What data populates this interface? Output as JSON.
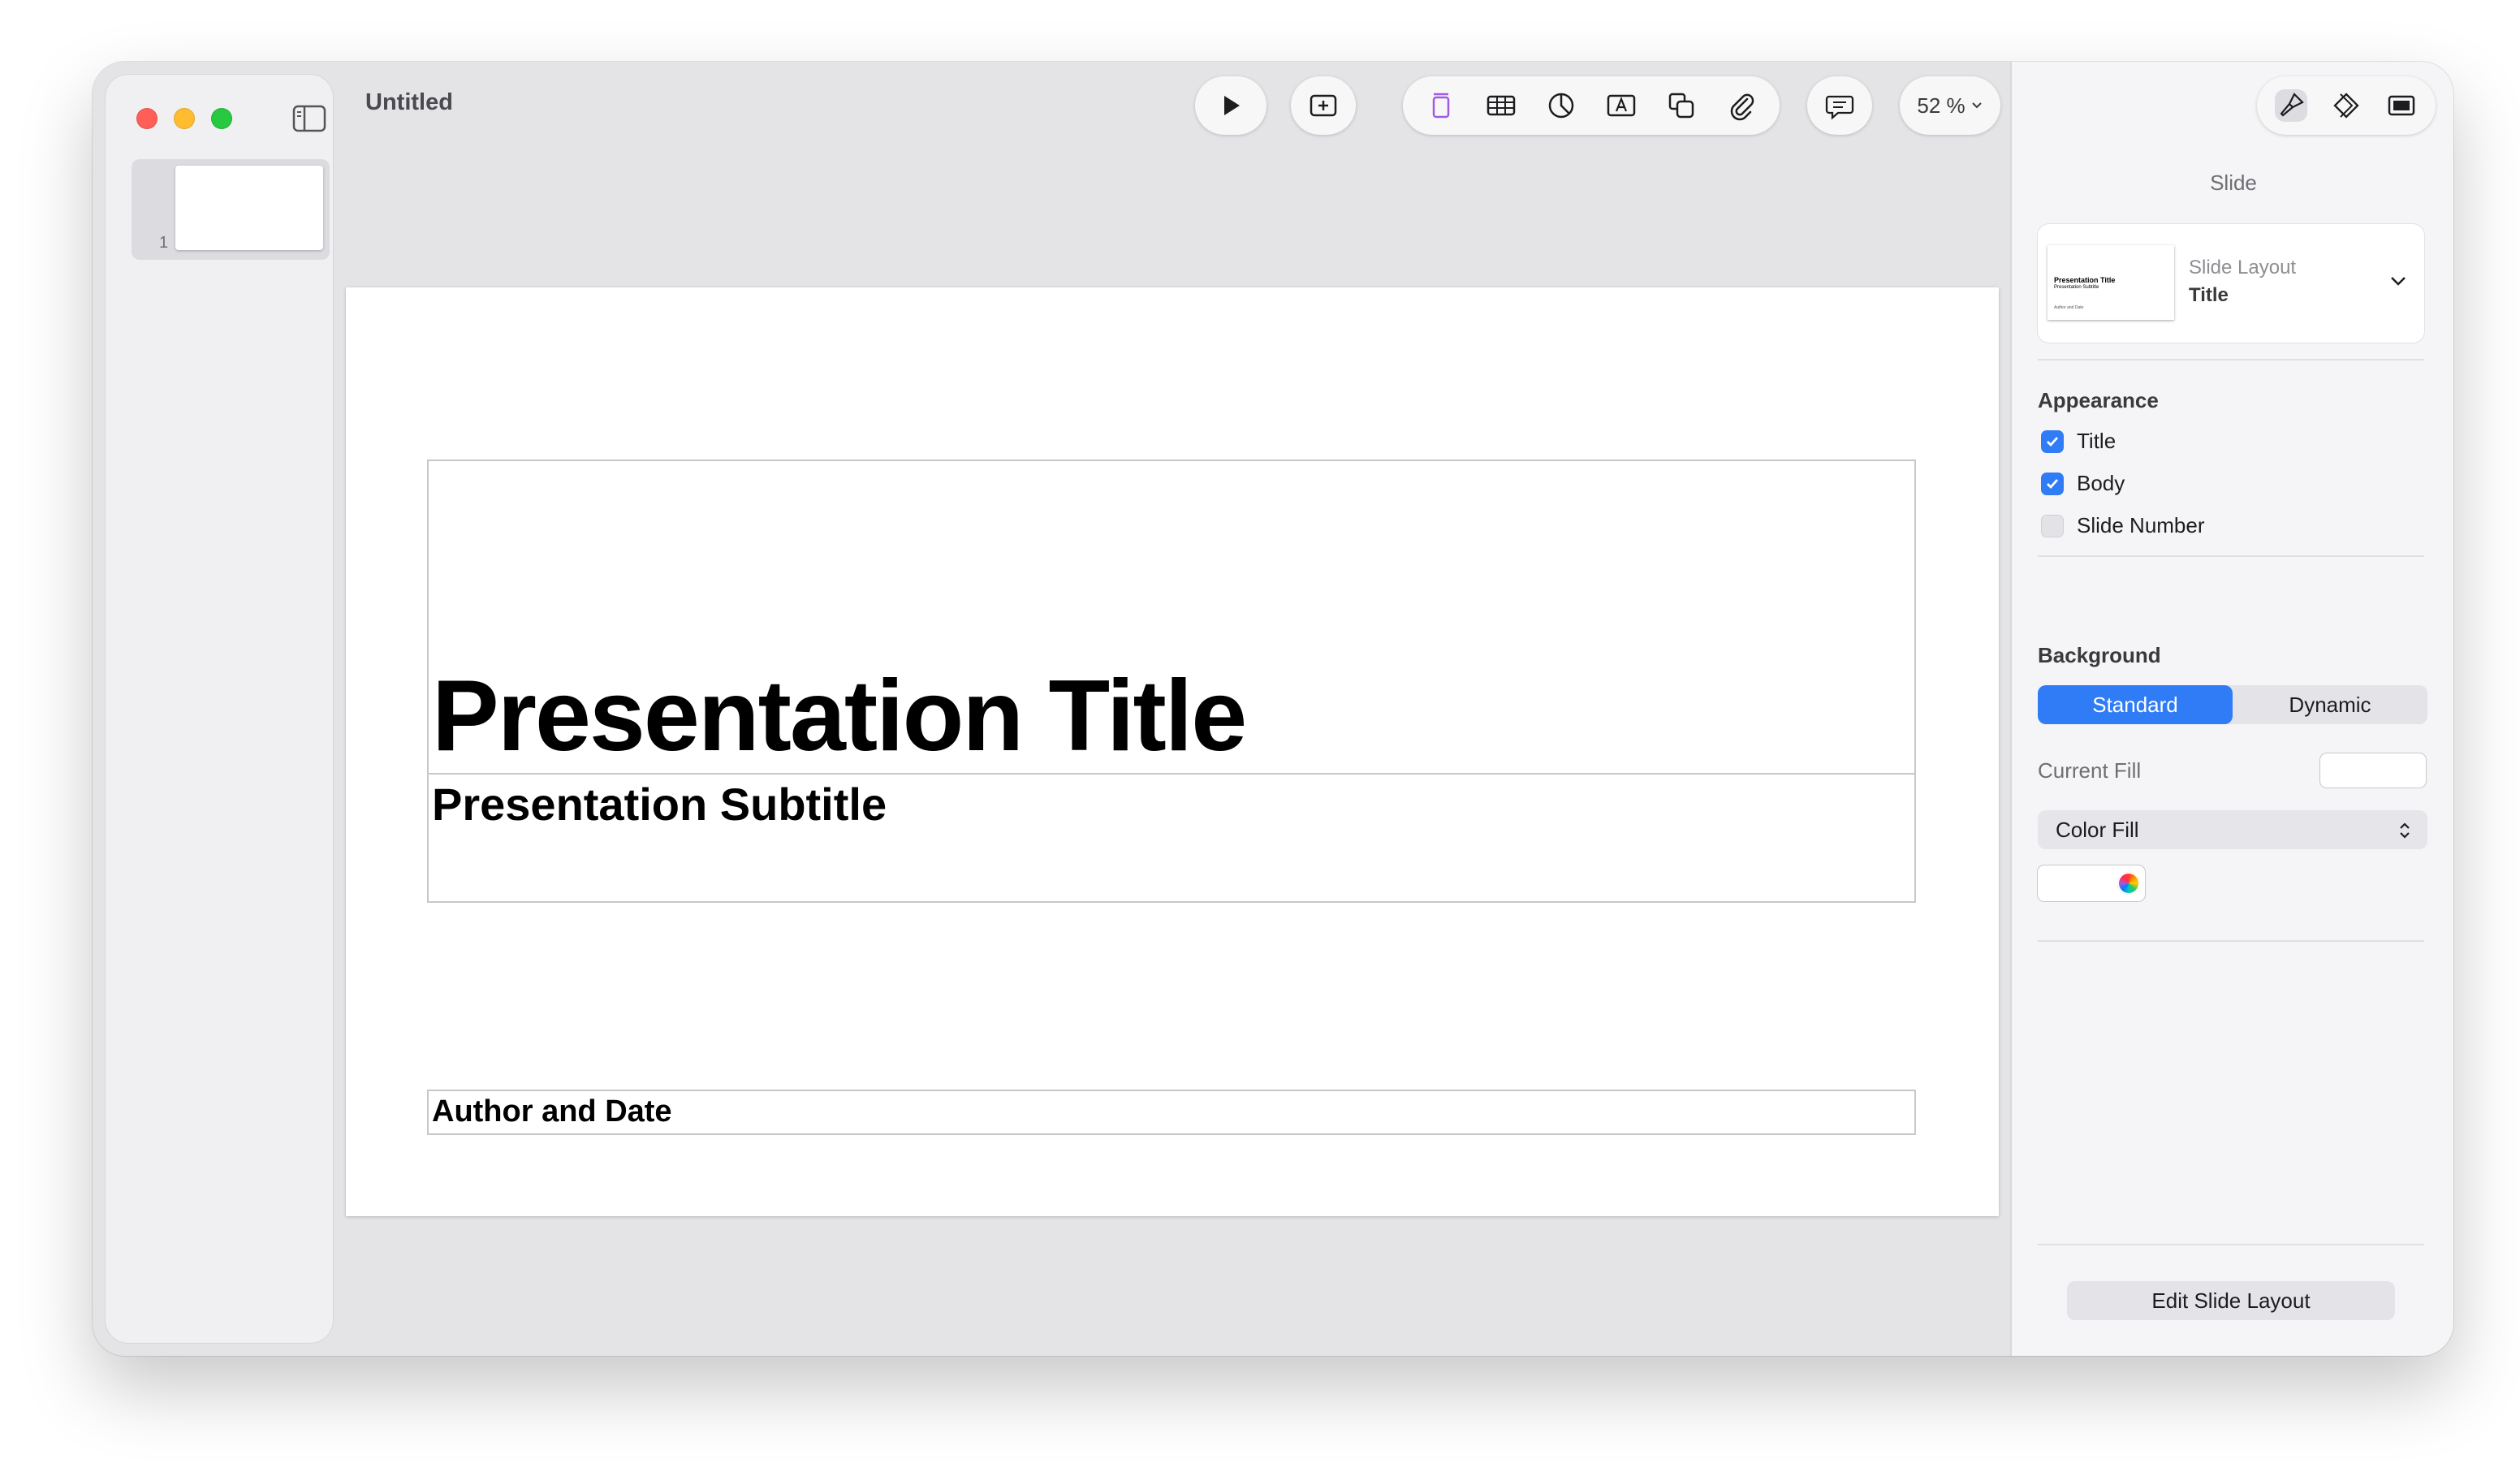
{
  "window": {
    "title": "Untitled"
  },
  "navigator": {
    "slides": [
      {
        "number": "1"
      }
    ]
  },
  "toolbar": {
    "play_icon": "play-icon",
    "add_slide_icon": "add-slide-icon",
    "insert_icons": [
      "text-box-icon",
      "table-icon",
      "chart-icon",
      "text-icon",
      "shape-icon",
      "media-icon"
    ],
    "comment_icon": "comment-icon",
    "zoom": "52 %",
    "share_icon": "share-icon",
    "inspector_icons": [
      "format-brush-icon",
      "animate-icon",
      "document-icon"
    ]
  },
  "slide": {
    "title": "Presentation Title",
    "subtitle": "Presentation Subtitle",
    "author": "Author and Date"
  },
  "inspector": {
    "heading": "Slide",
    "layout_label": "Slide Layout",
    "layout_value": "Title",
    "layout_thumb": {
      "title": "Presentation Title",
      "subtitle": "Presentation Subtitle",
      "author": "Author and Date"
    },
    "appearance_label": "Appearance",
    "appearance": [
      {
        "label": "Title",
        "checked": true
      },
      {
        "label": "Body",
        "checked": true
      },
      {
        "label": "Slide Number",
        "checked": false
      }
    ],
    "background_label": "Background",
    "background_options": [
      "Standard",
      "Dynamic"
    ],
    "background_selected": "Standard",
    "current_fill_label": "Current Fill",
    "fill_type": "Color Fill",
    "edit_layout_label": "Edit Slide Layout"
  },
  "colors": {
    "accent": "#2f7cf6",
    "close": "#ff5f57",
    "minimize": "#febc2e",
    "zoom": "#28c840"
  }
}
